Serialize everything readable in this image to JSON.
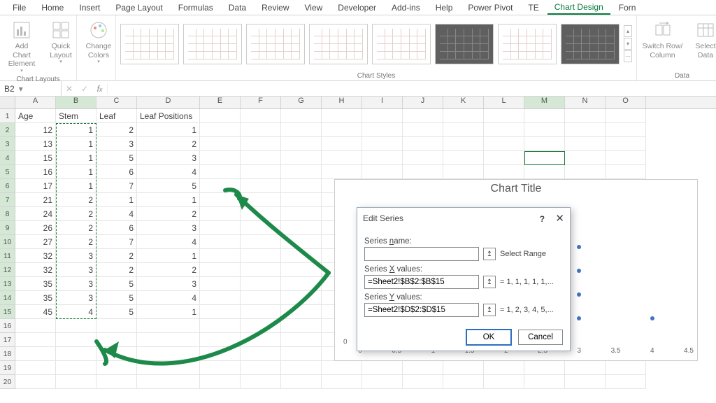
{
  "menu": [
    "File",
    "Home",
    "Insert",
    "Page Layout",
    "Formulas",
    "Data",
    "Review",
    "View",
    "Developer",
    "Add-ins",
    "Help",
    "Power Pivot",
    "TE",
    "Chart Design",
    "Forn"
  ],
  "menu_active_index": 13,
  "ribbon": {
    "layouts": {
      "addChartElement": "Add Chart Element",
      "quickLayout": "Quick Layout",
      "label": "Chart Layouts"
    },
    "colors": {
      "changeColors": "Change Colors"
    },
    "styles_label": "Chart Styles",
    "data": {
      "switchRowCol": "Switch Row/\nColumn",
      "selectData": "Select\nData",
      "label": "Data"
    }
  },
  "formula_bar": {
    "name_box": "B2"
  },
  "columns": [
    "A",
    "B",
    "C",
    "D",
    "E",
    "F",
    "G",
    "H",
    "I",
    "J",
    "K",
    "L",
    "M",
    "N",
    "O"
  ],
  "headers": {
    "A": "Age",
    "B": "Stem",
    "C": "Leaf",
    "D": "Leaf Positions"
  },
  "table": [
    {
      "r": 2,
      "A": 12,
      "B": 1,
      "C": 2,
      "D": 1
    },
    {
      "r": 3,
      "A": 13,
      "B": 1,
      "C": 3,
      "D": 2
    },
    {
      "r": 4,
      "A": 15,
      "B": 1,
      "C": 5,
      "D": 3
    },
    {
      "r": 5,
      "A": 16,
      "B": 1,
      "C": 6,
      "D": 4
    },
    {
      "r": 6,
      "A": 17,
      "B": 1,
      "C": 7,
      "D": 5
    },
    {
      "r": 7,
      "A": 21,
      "B": 2,
      "C": 1,
      "D": 1
    },
    {
      "r": 8,
      "A": 24,
      "B": 2,
      "C": 4,
      "D": 2
    },
    {
      "r": 9,
      "A": 26,
      "B": 2,
      "C": 6,
      "D": 3
    },
    {
      "r": 10,
      "A": 27,
      "B": 2,
      "C": 7,
      "D": 4
    },
    {
      "r": 11,
      "A": 32,
      "B": 3,
      "C": 2,
      "D": 1
    },
    {
      "r": 12,
      "A": 32,
      "B": 3,
      "C": 2,
      "D": 2
    },
    {
      "r": 13,
      "A": 35,
      "B": 3,
      "C": 5,
      "D": 3
    },
    {
      "r": 14,
      "A": 35,
      "B": 3,
      "C": 5,
      "D": 4
    },
    {
      "r": 15,
      "A": 45,
      "B": 4,
      "C": 5,
      "D": 1
    }
  ],
  "chart_data": {
    "type": "scatter",
    "title": "Chart Title",
    "xlabel": "",
    "ylabel": "",
    "x": [
      1,
      1,
      1,
      1,
      1,
      2,
      2,
      2,
      2,
      3,
      3,
      3,
      3,
      4
    ],
    "y": [
      1,
      2,
      3,
      4,
      5,
      1,
      2,
      3,
      4,
      1,
      2,
      3,
      4,
      1
    ],
    "xlim": [
      0,
      4.5
    ],
    "ylim": [
      0,
      6
    ],
    "xticks": [
      0,
      0.5,
      1,
      1.5,
      2,
      2.5,
      3,
      3.5,
      4,
      4.5
    ],
    "yticks": [
      0
    ]
  },
  "dialog": {
    "title": "Edit Series",
    "series_name_label": "Series name:",
    "series_name_value": "",
    "series_x_label": "Series X values:",
    "series_x_value": "=Sheet2!$B$2:$B$15",
    "series_x_hint": "= 1, 1, 1, 1, 1,...",
    "series_y_label": "Series Y values:",
    "series_y_value": "=Sheet2!$D$2:$D$15",
    "series_y_hint": "= 1, 2, 3, 4, 5,...",
    "select_range": "Select Range",
    "ok": "OK",
    "cancel": "Cancel"
  }
}
